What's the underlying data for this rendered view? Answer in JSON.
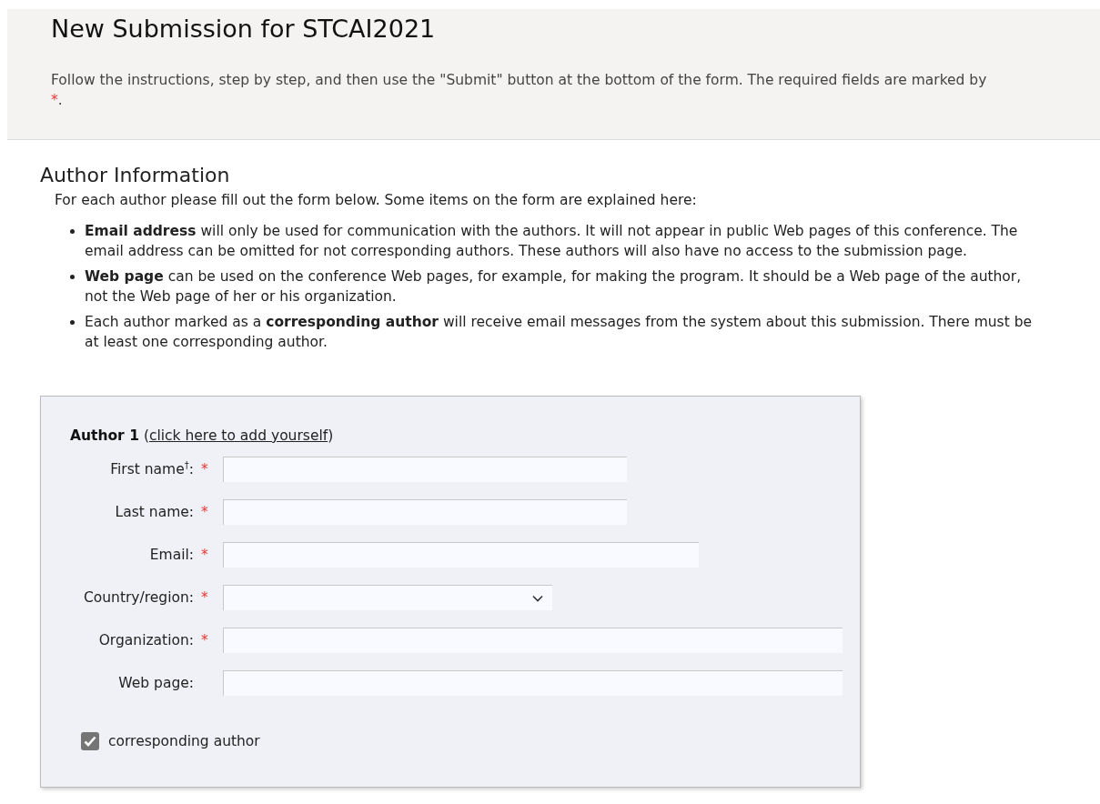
{
  "header": {
    "title": "New Submission for STCAI2021",
    "intro": "Follow the instructions, step by step, and then use the \"Submit\" button at the bottom of the form. The required fields are marked by",
    "intro_mark": "*",
    "intro_end": "."
  },
  "section": {
    "title": "Author Information",
    "lead": "For each author please fill out the form below. Some items on the form are explained here:",
    "bullets": [
      "**Email address** will only be used for communication with the authors. It will not appear in public Web pages of this conference. The email address can be omitted for not corresponding authors. These authors will also have no access to the submission page.",
      "**Web page** can be used on the conference Web pages, for example, for making the program. It should be a Web page of the author, not the Web page of her or his organization.",
      "Each author marked as a **corresponding author** will receive email messages from the system about this submission. There must be at least one corresponding author."
    ]
  },
  "author_form": {
    "title": "Author 1",
    "link_open": "(",
    "link": "click here to add yourself",
    "link_close": ")",
    "fields": [
      {
        "label": "First name",
        "note": "†",
        "colon": ":",
        "required": true,
        "kind": "name"
      },
      {
        "label": "Last name",
        "colon": ":",
        "required": true,
        "kind": "name"
      },
      {
        "label": "Email",
        "colon": ":",
        "required": true,
        "kind": "email"
      },
      {
        "label": "Country/region",
        "colon": ":",
        "required": true,
        "kind": "select"
      },
      {
        "label": "Organization",
        "colon": ":",
        "required": true,
        "kind": "wide"
      },
      {
        "label": "Web page",
        "colon": ":",
        "required": false,
        "kind": "wide"
      }
    ],
    "required_mark": "*",
    "corresponding": {
      "label": "corresponding author",
      "checked": true
    }
  }
}
